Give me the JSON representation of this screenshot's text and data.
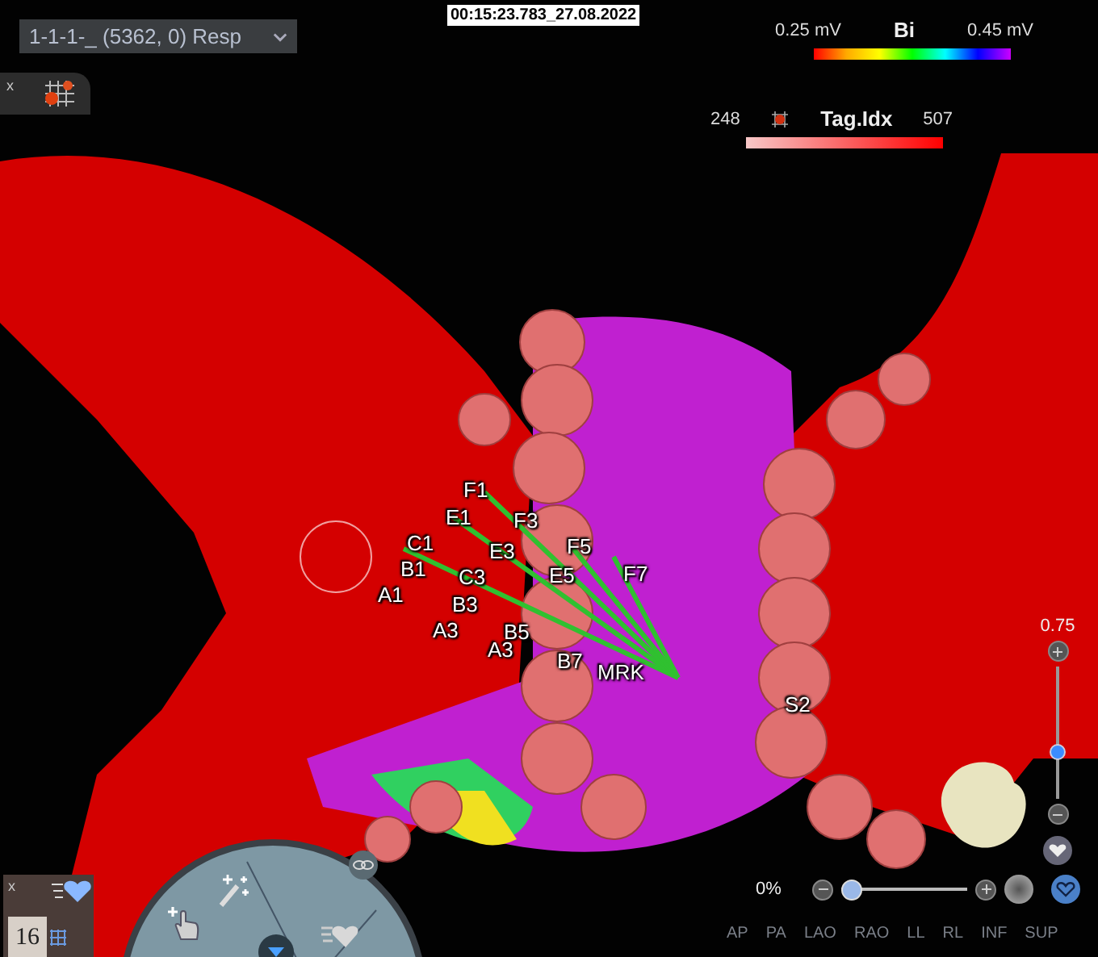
{
  "map_selector": {
    "value": "1-1-1-_ (5362, 0) Resp"
  },
  "top_panel": {
    "close": "x"
  },
  "timestamp": "00:15:23.783_27.08.2022",
  "voltage_legend": {
    "min": "0.25 mV",
    "title": "Bi",
    "max": "0.45 mV"
  },
  "tag_legend": {
    "min": "248",
    "title": "Tag.Idx",
    "max": "507"
  },
  "electrode_labels": [
    {
      "label": "F1"
    },
    {
      "label": "E1"
    },
    {
      "label": "C1"
    },
    {
      "label": "B1"
    },
    {
      "label": "A1"
    },
    {
      "label": "F3"
    },
    {
      "label": "E3"
    },
    {
      "label": "C3"
    },
    {
      "label": "B3"
    },
    {
      "label": "A3"
    },
    {
      "label": "F5"
    },
    {
      "label": "E5"
    },
    {
      "label": "B5"
    },
    {
      "label": "A3"
    },
    {
      "label": "F7"
    },
    {
      "label": "B7"
    },
    {
      "label": "MRK"
    },
    {
      "label": "S2"
    }
  ],
  "zoom_slider": {
    "reading": "0.75",
    "level": 0.35
  },
  "transparency_slider": {
    "reading": "0%",
    "level": 0.0
  },
  "bottom_panel": {
    "close": "x",
    "count": "16"
  },
  "view_buttons": [
    {
      "label": "AP"
    },
    {
      "label": "PA"
    },
    {
      "label": "LAO"
    },
    {
      "label": "RAO"
    },
    {
      "label": "LL"
    },
    {
      "label": "RL"
    },
    {
      "label": "INF"
    },
    {
      "label": "SUP"
    }
  ]
}
